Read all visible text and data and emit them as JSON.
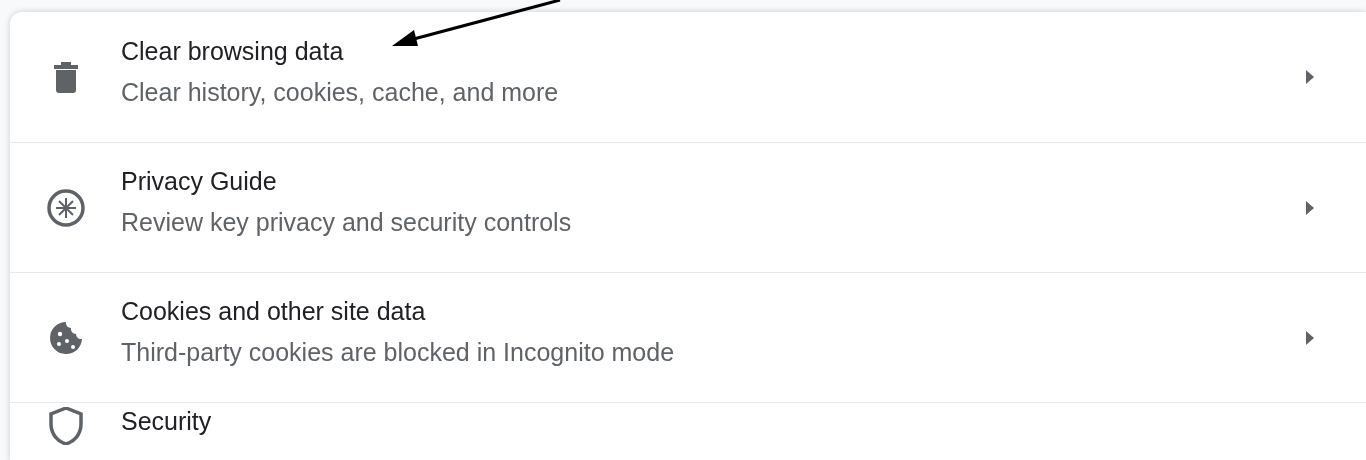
{
  "settings_rows": [
    {
      "title": "Clear browsing data",
      "subtitle": "Clear history, cookies, cache, and more"
    },
    {
      "title": "Privacy Guide",
      "subtitle": "Review key privacy and security controls"
    },
    {
      "title": "Cookies and other site data",
      "subtitle": "Third-party cookies are blocked in Incognito mode"
    },
    {
      "title": "Security"
    }
  ]
}
